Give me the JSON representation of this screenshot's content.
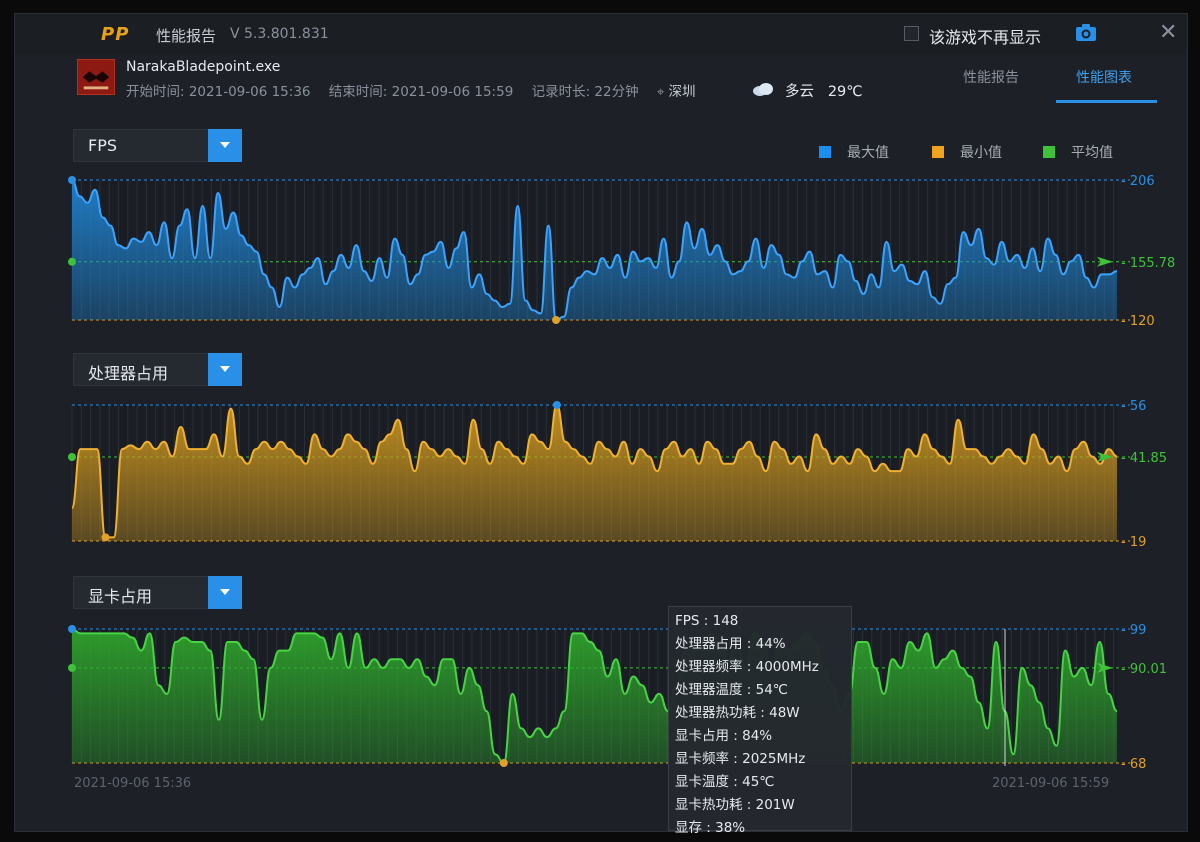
{
  "app": {
    "logo_text": "PP",
    "title": "性能报告",
    "version": "V 5.3.801.831",
    "hide_game_label": "该游戏不再显示"
  },
  "session": {
    "game_name": "NarakaBladepoint.exe",
    "start": "开始时间: 2021-09-06 15:36",
    "end": "结束时间: 2021-09-06 15:59",
    "duration": "记录时长: 22分钟",
    "city": "深圳",
    "weather": "多云",
    "temperature": "29℃"
  },
  "tabs": [
    {
      "label": "性能报告",
      "active": false
    },
    {
      "label": "性能图表",
      "active": true
    }
  ],
  "legend": [
    {
      "label": "最大值",
      "color": "#1a8ff0"
    },
    {
      "label": "最小值",
      "color": "#f0a21c"
    },
    {
      "label": "平均值",
      "color": "#3fc13a"
    }
  ],
  "chart_data": [
    {
      "type": "area",
      "title": "FPS",
      "max": 206,
      "min": 120,
      "avg": 155.78,
      "max_label": "206",
      "min_label": "120",
      "avg_label": "155.78",
      "color": "#1f86d6",
      "values": [
        206,
        196,
        192,
        200,
        183,
        178,
        166,
        164,
        170,
        168,
        174,
        166,
        180,
        158,
        178,
        188,
        158,
        190,
        158,
        198,
        176,
        186,
        172,
        166,
        162,
        148,
        140,
        128,
        146,
        140,
        148,
        152,
        158,
        142,
        150,
        160,
        152,
        166,
        150,
        144,
        158,
        146,
        170,
        160,
        142,
        148,
        160,
        162,
        168,
        152,
        164,
        174,
        140,
        148,
        136,
        132,
        128,
        130,
        190,
        132,
        126,
        124,
        178,
        120,
        122,
        140,
        146,
        150,
        148,
        158,
        152,
        160,
        146,
        162,
        156,
        158,
        152,
        170,
        146,
        156,
        180,
        164,
        176,
        160,
        166,
        156,
        148,
        150,
        156,
        170,
        152,
        166,
        160,
        148,
        146,
        156,
        162,
        148,
        150,
        140,
        160,
        156,
        144,
        136,
        148,
        140,
        168,
        150,
        154,
        144,
        142,
        150,
        134,
        130,
        142,
        146,
        174,
        166,
        176,
        158,
        154,
        168,
        156,
        160,
        152,
        164,
        150,
        170,
        160,
        148,
        156,
        160,
        146,
        140,
        148,
        148,
        150
      ]
    },
    {
      "type": "area",
      "title": "处理器占用",
      "max": 56,
      "min": 19,
      "avg": 41.85,
      "max_label": "56",
      "min_label": "19",
      "avg_label": "41.85",
      "color": "#d29a1e",
      "values": [
        28,
        44,
        44,
        44,
        20,
        20,
        44,
        45,
        44,
        46,
        44,
        46,
        42,
        50,
        44,
        44,
        44,
        48,
        42,
        55,
        42,
        40,
        44,
        46,
        44,
        46,
        44,
        42,
        40,
        48,
        44,
        42,
        44,
        48,
        46,
        44,
        40,
        46,
        48,
        52,
        44,
        38,
        46,
        44,
        42,
        44,
        42,
        40,
        52,
        44,
        40,
        46,
        44,
        42,
        40,
        48,
        46,
        44,
        56,
        46,
        44,
        42,
        40,
        46,
        44,
        42,
        46,
        40,
        44,
        42,
        38,
        44,
        46,
        42,
        44,
        40,
        46,
        44,
        40,
        40,
        44,
        46,
        42,
        38,
        46,
        44,
        40,
        42,
        38,
        48,
        44,
        40,
        42,
        40,
        44,
        42,
        38,
        40,
        38,
        38,
        44,
        42,
        48,
        44,
        42,
        40,
        52,
        44,
        44,
        42,
        40,
        42,
        44,
        42,
        40,
        48,
        44,
        40,
        42,
        38,
        44,
        46,
        42,
        40,
        44,
        42
      ]
    },
    {
      "type": "area",
      "title": "显卡占用",
      "max": 99,
      "min": 68,
      "avg": 90.01,
      "max_label": "99",
      "min_label": "68",
      "avg_label": "90.01",
      "color": "#2fa92c",
      "values": [
        99,
        98,
        98,
        98,
        98,
        98,
        98,
        97,
        94,
        98,
        86,
        84,
        96,
        97,
        96,
        96,
        94,
        78,
        96,
        96,
        94,
        92,
        78,
        90,
        94,
        94,
        98,
        98,
        98,
        97,
        92,
        98,
        90,
        98,
        90,
        92,
        90,
        92,
        92,
        90,
        92,
        88,
        86,
        92,
        92,
        84,
        90,
        86,
        80,
        70,
        68,
        84,
        76,
        74,
        76,
        74,
        76,
        80,
        98,
        98,
        96,
        94,
        88,
        92,
        84,
        88,
        86,
        82,
        84,
        80,
        86,
        94,
        94,
        96,
        98,
        96,
        92,
        96,
        90,
        98,
        96,
        90,
        96,
        94,
        96,
        98,
        96,
        90,
        86,
        80,
        84,
        96,
        96,
        90,
        84,
        92,
        90,
        96,
        94,
        98,
        90,
        92,
        94,
        90,
        88,
        82,
        76,
        96,
        80,
        70,
        90,
        86,
        82,
        76,
        72,
        94,
        88,
        90,
        86,
        96,
        84,
        80
      ]
    }
  ],
  "tooltip": [
    "FPS : 148",
    "处理器占用 : 44%",
    "处理器频率 : 4000MHz",
    "处理器温度 : 54℃",
    "处理器热功耗 : 48W",
    "显卡占用 : 84%",
    "显卡频率 : 2025MHz",
    "显卡温度 : 45℃",
    "显卡热功耗 : 201W",
    "显存 : 38%"
  ],
  "footer": {
    "start_time": "2021-09-06 15:36",
    "end_time": "2021-09-06 15:59"
  }
}
